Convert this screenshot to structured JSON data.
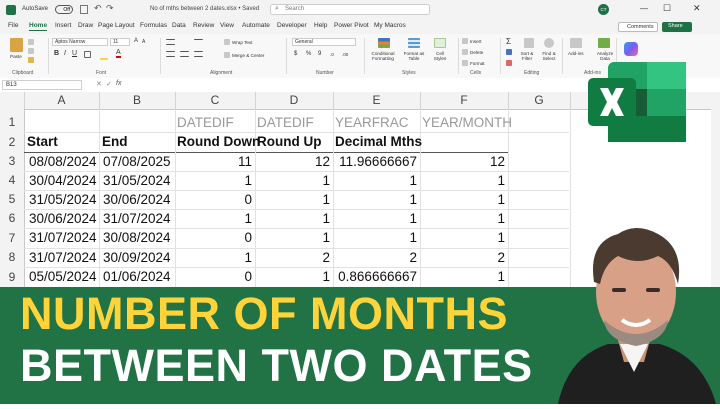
{
  "window": {
    "file_name": "No of mths between 2 dates.xlsx • Saved",
    "search_placeholder": "Search",
    "autosave_label": "AutoSave",
    "autosave_state": "Off",
    "comments_label": "Comments",
    "share_label": "Share",
    "user_initials": "CT"
  },
  "ribbon_tabs": [
    "File",
    "Home",
    "Insert",
    "Draw",
    "Page Layout",
    "Formulas",
    "Data",
    "Review",
    "View",
    "Automate",
    "Developer",
    "Help",
    "Power Pivot",
    "My Macros"
  ],
  "ribbon": {
    "paste": "Paste",
    "font_name": "Aptos Narrow",
    "font_size": "11",
    "wrap_text": "Wrap Text",
    "merge_center": "Merge & Center",
    "number_format": "General",
    "conditional_formatting": "Conditional Formatting",
    "format_as_table": "Format as Table",
    "cell_styles": "Cell Styles",
    "insert": "Insert",
    "delete": "Delete",
    "format": "Format",
    "sort_filter": "Sort & Filter",
    "find_select": "Find & Select",
    "add_ins": "Add-ins",
    "analyze_data": "Analyze Data",
    "groups": [
      "Clipboard",
      "Font",
      "Alignment",
      "Number",
      "Styles",
      "Cells",
      "Editing",
      "Add-ins"
    ]
  },
  "formula_bar": {
    "name_box": "B13",
    "fx": "fx"
  },
  "columns": [
    "A",
    "B",
    "C",
    "D",
    "E",
    "F",
    "G"
  ],
  "row_numbers": [
    "1",
    "2",
    "3",
    "4",
    "5",
    "6",
    "7",
    "8",
    "9"
  ],
  "row1": [
    "",
    "",
    "DATEDIF",
    "DATEDIF",
    "YEARFRAC",
    "YEAR/MONTH"
  ],
  "row2": [
    "Start",
    "End",
    "Round Down",
    "Round Up",
    "Decimal Mths",
    ""
  ],
  "rows": [
    [
      "08/08/2024",
      "07/08/2025",
      "11",
      "12",
      "11.96666667",
      "12"
    ],
    [
      "30/04/2024",
      "31/05/2024",
      "1",
      "1",
      "1",
      "1"
    ],
    [
      "31/05/2024",
      "30/06/2024",
      "0",
      "1",
      "1",
      "1"
    ],
    [
      "30/06/2024",
      "31/07/2024",
      "1",
      "1",
      "1",
      "1"
    ],
    [
      "31/07/2024",
      "30/08/2024",
      "0",
      "1",
      "1",
      "1"
    ],
    [
      "31/07/2024",
      "30/09/2024",
      "1",
      "2",
      "2",
      "2"
    ],
    [
      "05/05/2024",
      "01/06/2024",
      "0",
      "1",
      "0.866666667",
      "1"
    ]
  ],
  "banner": {
    "line1": "NUMBER OF MONTHS",
    "line2": "BETWEEN TWO DATES"
  },
  "colors": {
    "excel_green": "#217346",
    "yellow": "#ffd43b"
  },
  "icons": [
    "excel-logo-icon",
    "presenter-photo"
  ]
}
